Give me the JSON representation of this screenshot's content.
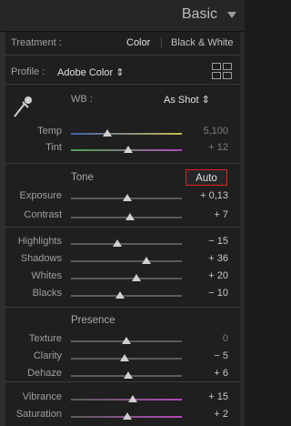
{
  "header": {
    "title": "Basic"
  },
  "treatment": {
    "label": "Treatment :",
    "option_color": "Color",
    "option_bw": "Black & White"
  },
  "profile": {
    "label": "Profile :",
    "value": "Adobe Color ⇕"
  },
  "wb": {
    "label": "WB :",
    "value": "As Shot ⇕"
  },
  "wb_sliders": [
    {
      "label": "Temp",
      "value": "5,100",
      "level": 0.33,
      "track_gradient": [
        "#3d5fa8",
        "#c9b94c"
      ],
      "dim": true
    },
    {
      "label": "Tint",
      "value": "+ 12",
      "level": 0.52,
      "track_gradient": [
        "#48a64c",
        "#b04ab8"
      ],
      "dim": true
    }
  ],
  "tone": {
    "title": "Tone",
    "auto_label": "Auto",
    "sliders": [
      {
        "label": "Exposure",
        "value": "+ 0,13",
        "level": 0.51
      },
      {
        "label": "Contrast",
        "value": "+ 7",
        "level": 0.53
      }
    ],
    "sliders2": [
      {
        "label": "Highlights",
        "value": "− 15",
        "level": 0.42
      },
      {
        "label": "Shadows",
        "value": "+ 36",
        "level": 0.68
      },
      {
        "label": "Whites",
        "value": "+ 20",
        "level": 0.59
      },
      {
        "label": "Blacks",
        "value": "− 10",
        "level": 0.44
      }
    ]
  },
  "presence": {
    "title": "Presence",
    "sliders": [
      {
        "label": "Texture",
        "value": "0",
        "level": 0.5,
        "dim": true
      },
      {
        "label": "Clarity",
        "value": "− 5",
        "level": 0.48
      },
      {
        "label": "Dehaze",
        "value": "+ 6",
        "level": 0.52
      }
    ],
    "sliders2": [
      {
        "label": "Vibrance",
        "value": "+ 15",
        "level": 0.56,
        "track_gradient": [
          "#5a5a5a",
          "#b14ab8"
        ]
      },
      {
        "label": "Saturation",
        "value": "+ 2",
        "level": 0.51,
        "track_gradient": [
          "#5a5a5a",
          "#b14ab8"
        ]
      }
    ]
  }
}
